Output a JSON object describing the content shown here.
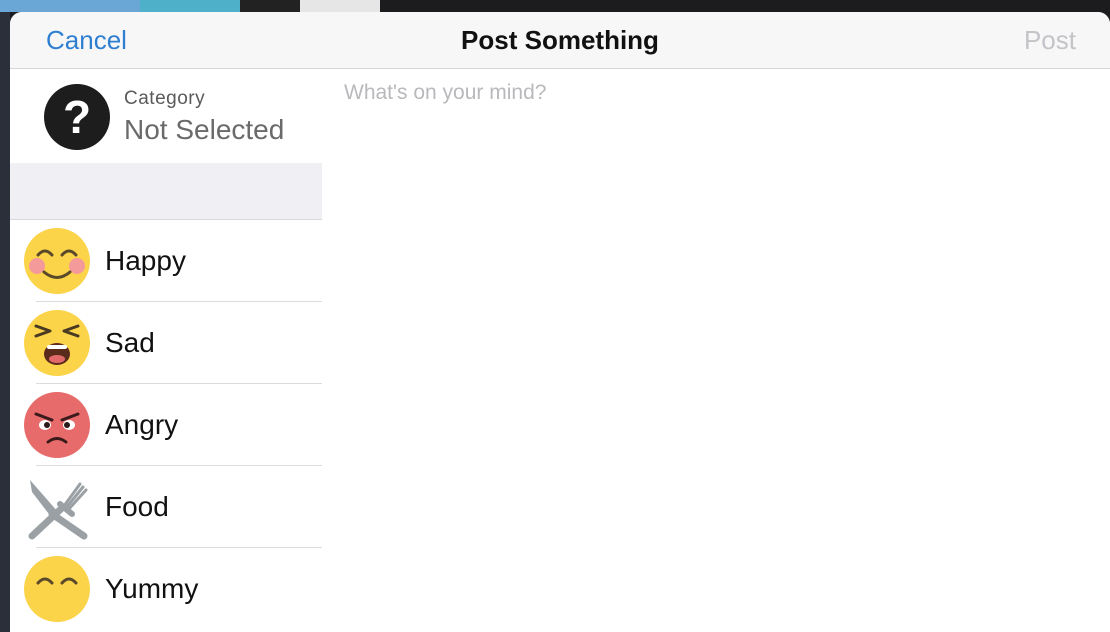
{
  "navbar": {
    "cancel_label": "Cancel",
    "title": "Post Something",
    "post_label": "Post"
  },
  "category": {
    "label": "Category",
    "value": "Not Selected",
    "icon": "question-mark-icon"
  },
  "moods": [
    {
      "label": "Happy",
      "icon": "smiling-blush-face-icon"
    },
    {
      "label": "Sad",
      "icon": "tired-crying-face-icon"
    },
    {
      "label": "Angry",
      "icon": "angry-red-face-icon"
    },
    {
      "label": "Food",
      "icon": "fork-and-knife-icon"
    },
    {
      "label": "Yummy",
      "icon": "yummy-face-icon"
    }
  ],
  "composer": {
    "placeholder": "What's on your mind?",
    "value": ""
  },
  "colors": {
    "accent": "#2f7fd1",
    "disabled": "#c4c4c8",
    "emoji_yellow": "#fbd44a",
    "angry_red": "#e76b6b"
  }
}
